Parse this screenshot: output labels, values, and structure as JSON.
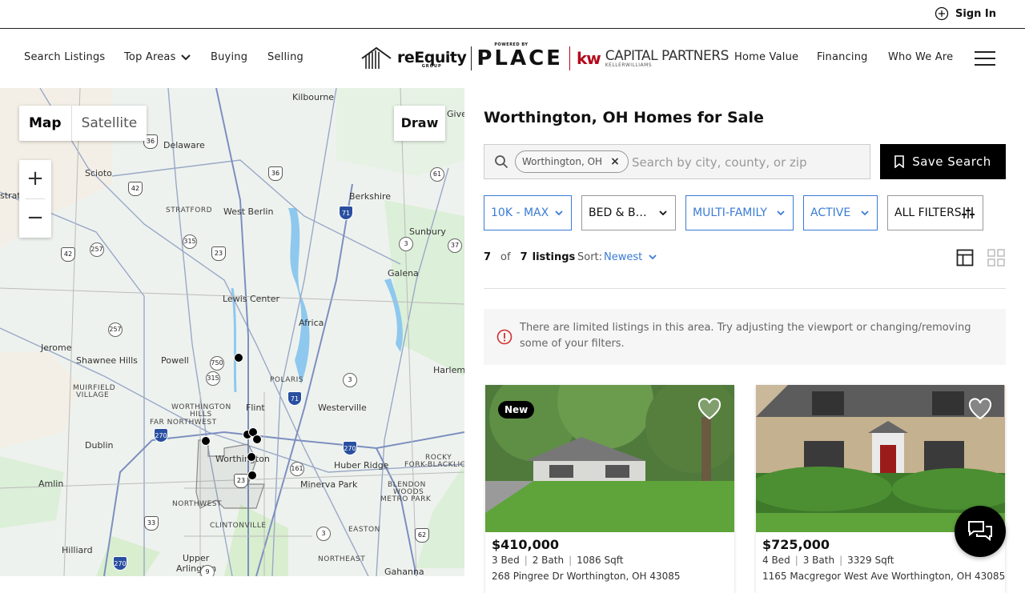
{
  "topbar": {
    "signin_label": "Sign In"
  },
  "nav": {
    "left": [
      "Search Listings",
      "Top Areas",
      "Buying",
      "Selling"
    ],
    "right": [
      "Home Value",
      "Financing",
      "Who We Are"
    ]
  },
  "logo": {
    "brand": "reEquity",
    "brand_sub": "GROUP",
    "powered": "POWERED BY",
    "place": "PLACE",
    "kw": "kw",
    "partner": "CAPITAL PARTNERS",
    "partner_sub": "KELLERWILLIAMS"
  },
  "map": {
    "type_map": "Map",
    "type_satellite": "Satellite",
    "draw": "Draw",
    "zoom_in": "+",
    "zoom_out": "−",
    "labels": {
      "kilbourne": "Kilbourne",
      "delaware": "Delaware",
      "scioto": "Scioto",
      "strat": "strat",
      "berkshire": "Berkshire",
      "stratford": "STRATFORD",
      "westberlin": "West Berlin",
      "sunbury": "Sunbury",
      "galena": "Galena",
      "lewiscenter": "Lewis Center",
      "africa": "Africa",
      "jerome": "Jerome",
      "shawneehills": "Shawnee Hills",
      "powell": "Powell",
      "polaris": "POLARIS",
      "harlem": "Harlem",
      "muirfield": "MUIRFIELD",
      "village": "VILLAGE",
      "worthingtonhills": "WORTHINGTON",
      "hills": "HILLS",
      "flint": "Flint",
      "westerville": "Westerville",
      "farnorthwest": "FAR NORTHWEST",
      "dublin": "Dublin",
      "worthington": "Worthington",
      "huberridge": "Huber Ridge",
      "rocky": "ROCKY",
      "forkblacklick": "FORK-BLACKLICK",
      "amlin": "Amlin",
      "minervapark": "Minerva Park",
      "blendon": "BLENDON",
      "woods": "WOODS",
      "metropark": "METRO PARK",
      "northwest": "NORTHWEST",
      "clintonville": "CLINTONVILLE",
      "easton": "EASTON",
      "hilliard": "Hilliard",
      "upper": "Upper",
      "arlington": "Arlington",
      "northeast": "NORTHEAST",
      "gahanna": "Gahanna",
      "give": "Give"
    },
    "routes": {
      "r36a": "36",
      "r36b": "36",
      "r42a": "42",
      "r42b": "42",
      "r61": "61",
      "r71a": "71",
      "r71b": "71",
      "r315a": "315",
      "r315b": "315",
      "r23a": "23",
      "r23b": "23",
      "r257a": "257",
      "r257b": "257",
      "r37": "37",
      "r3a": "3",
      "r3b": "3",
      "r3c": "3",
      "r750": "750",
      "r270a": "270",
      "r270b": "270",
      "r270c": "270",
      "r161": "161",
      "r33": "33",
      "r62": "62",
      "r9": "9"
    }
  },
  "panel": {
    "title": "Worthington, OH Homes for Sale",
    "chip": "Worthington, OH",
    "search_placeholder": "Search by city, county, or zip",
    "save_search": "Save Search",
    "filters": {
      "price": "10K - MAX",
      "bedbath": "BED & BATH",
      "type": "MULTI-FAMILY",
      "status": "ACTIVE",
      "all": "ALL FILTERS"
    },
    "count_shown": "7",
    "count_of": "of",
    "count_total": "7",
    "count_label": "listings",
    "sort_label": "Sort:",
    "sort_value": "Newest",
    "notice": "There are limited listings in this area. Try adjusting the viewport or changing/removing some of your filters."
  },
  "listings": [
    {
      "badge": "New",
      "price": "$410,000",
      "beds": "3 Bed",
      "baths": "2 Bath",
      "sqft": "1086 Sqft",
      "address": "268 Pingree Dr Worthington, OH 43085"
    },
    {
      "badge": "",
      "price": "$725,000",
      "beds": "4 Bed",
      "baths": "3 Bath",
      "sqft": "3329 Sqft",
      "address": "1165 Macgregor West Ave Worthington, OH 43085"
    }
  ],
  "colors": {
    "accent_blue": "#3a7bd5",
    "brand_red": "#b40a1c",
    "notice_red": "#d32f2f"
  }
}
